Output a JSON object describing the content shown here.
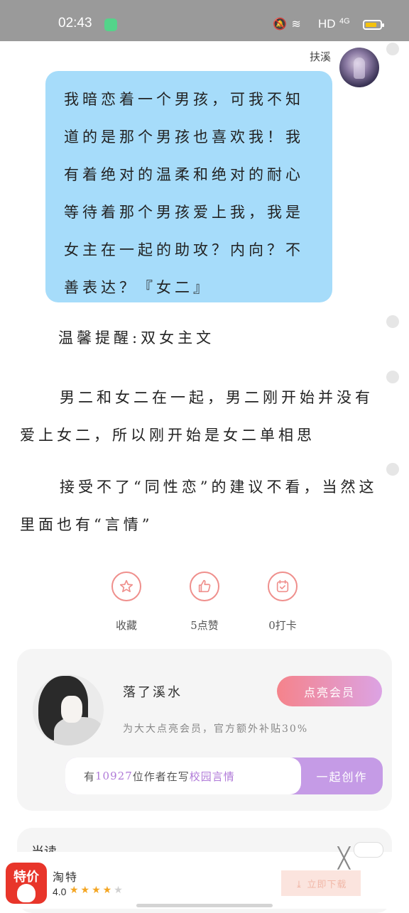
{
  "status_bar": {
    "time": "02:43",
    "icons": "🔕 ≋",
    "hd": "HD",
    "network": "4G",
    "battery_color": "#f4c20d"
  },
  "chat": {
    "sender_name": "扶溪",
    "message": "我暗恋着一个男孩，可我不知道的是那个男孩也喜欢我！我有着绝对的温柔和绝对的耐心等待着那个男孩爱上我，我是女主在一起的助攻？内向？不善表达？『女二』"
  },
  "content": {
    "tip": "温馨提醒:双女主文",
    "body1": "男二和女二在一起，男二刚开始并没有爱上女二，所以刚开始是女二单相思",
    "body2": "接受不了“同性恋”的建议不看，当然这里面也有“言情”"
  },
  "actions": [
    {
      "icon": "star-icon",
      "label": "收藏"
    },
    {
      "icon": "thumbs-up-icon",
      "label": "5点赞"
    },
    {
      "icon": "checkin-icon",
      "label": "0打卡"
    }
  ],
  "author_card": {
    "name": "落了溪水",
    "vip_button": "点亮会员",
    "vip_desc": "为大大点亮会员，官方额外补贴30%",
    "create_prefix": "有",
    "create_count": "10927",
    "create_middle": "位作者在写",
    "create_genre": "校园言情",
    "create_button": "一起创作"
  },
  "next_card": {
    "title_partial": "当读"
  },
  "ad": {
    "icon_text": "特价",
    "name": "淘特",
    "rating": "4.0",
    "stars": "★★★★",
    "star_off": "★",
    "download_label": "⤓ 立即下载",
    "close": "╳"
  }
}
